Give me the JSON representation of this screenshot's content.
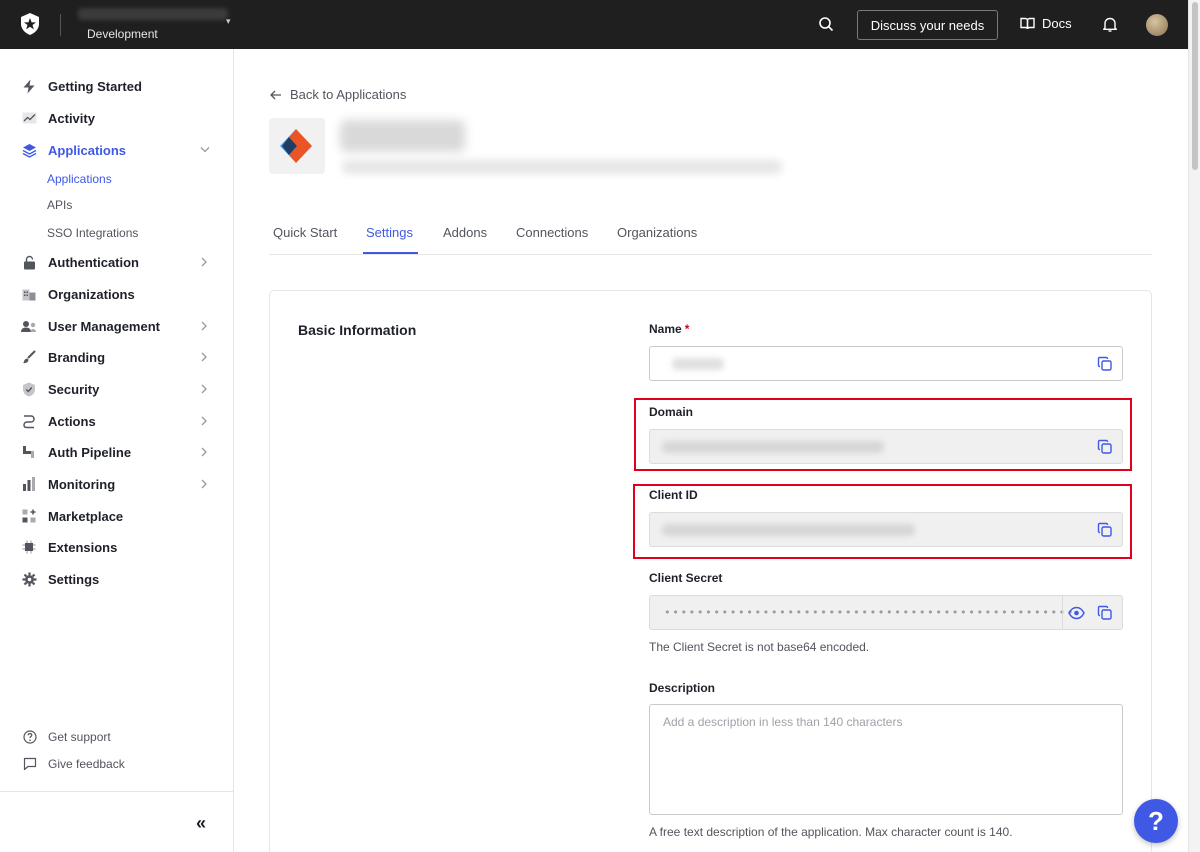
{
  "topbar": {
    "environment": "Development",
    "discuss_label": "Discuss your needs",
    "docs_label": "Docs"
  },
  "sidebar": {
    "items": [
      {
        "label": "Getting Started",
        "icon": "bolt-icon"
      },
      {
        "label": "Activity",
        "icon": "activity-chart-icon"
      },
      {
        "label": "Applications",
        "icon": "layers-icon",
        "active": true
      },
      {
        "label": "Authentication",
        "icon": "lock-icon"
      },
      {
        "label": "Organizations",
        "icon": "building-icon"
      },
      {
        "label": "User Management",
        "icon": "users-icon"
      },
      {
        "label": "Branding",
        "icon": "brush-icon"
      },
      {
        "label": "Security",
        "icon": "shield-icon"
      },
      {
        "label": "Actions",
        "icon": "flow-icon"
      },
      {
        "label": "Auth Pipeline",
        "icon": "pipeline-icon"
      },
      {
        "label": "Monitoring",
        "icon": "bar-chart-icon"
      },
      {
        "label": "Marketplace",
        "icon": "grid-plus-icon"
      },
      {
        "label": "Extensions",
        "icon": "chip-icon"
      },
      {
        "label": "Settings",
        "icon": "gear-icon"
      }
    ],
    "subitems": [
      {
        "label": "Applications",
        "active": true
      },
      {
        "label": "APIs"
      },
      {
        "label": "SSO Integrations"
      }
    ],
    "footer": {
      "support_label": "Get support",
      "feedback_label": "Give feedback",
      "collapse_label": "«"
    }
  },
  "main": {
    "back_label": "Back to Applications",
    "tabs": [
      {
        "label": "Quick Start"
      },
      {
        "label": "Settings",
        "active": true
      },
      {
        "label": "Addons"
      },
      {
        "label": "Connections"
      },
      {
        "label": "Organizations"
      }
    ],
    "section_title": "Basic Information",
    "fields": {
      "name_label": "Name",
      "required_mark": "*",
      "domain_label": "Domain",
      "client_id_label": "Client ID",
      "client_secret_label": "Client Secret",
      "client_secret_mask": "••••••••••••••••••••••••••••••••••••••••••••••••••",
      "client_secret_help": "The Client Secret is not base64 encoded.",
      "description_label": "Description",
      "description_placeholder": "Add a description in less than 140 characters",
      "description_help": "A free text description of the application. Max character count is 140."
    }
  },
  "help_bubble": "?",
  "colors": {
    "accent": "#3f59e4",
    "highlight": "#e0001b",
    "topbar": "#1f1f1f"
  }
}
